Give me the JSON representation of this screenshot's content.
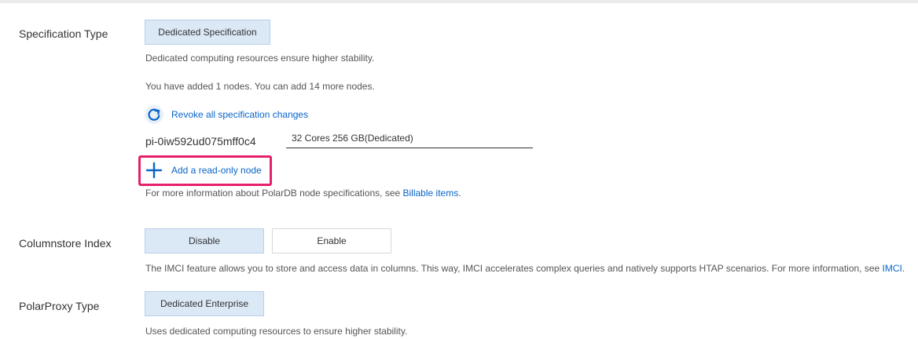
{
  "spec_type": {
    "label": "Specification Type",
    "button": "Dedicated Specification",
    "desc": "Dedicated computing resources ensure higher stability.",
    "nodes_info": "You have added 1 nodes. You can add 14 more nodes.",
    "revoke_label": "Revoke all specification changes",
    "node_id": "pi-0iw592ud075mff0c4",
    "node_spec": "32 Cores 256 GB(Dedicated)",
    "add_node_label": "Add a read-only node",
    "info_prefix": "For more information about PolarDB node specifications, see ",
    "info_link": "Billable items",
    "info_suffix": "."
  },
  "columnstore": {
    "label": "Columnstore Index",
    "disable": "Disable",
    "enable": "Enable",
    "selected": "Disable",
    "desc_prefix": "The IMCI feature allows you to store and access data in columns. This way, IMCI accelerates complex queries and natively supports HTAP scenarios. For more information, see ",
    "desc_link": "IMCI",
    "desc_suffix": "."
  },
  "polarproxy": {
    "label": "PolarProxy Type",
    "button": "Dedicated Enterprise",
    "desc": "Uses dedicated computing resources to ensure higher stability."
  },
  "colors": {
    "link": "#0a64c8",
    "active_button_bg": "#dbe8f6",
    "highlight": "#e6206a"
  }
}
